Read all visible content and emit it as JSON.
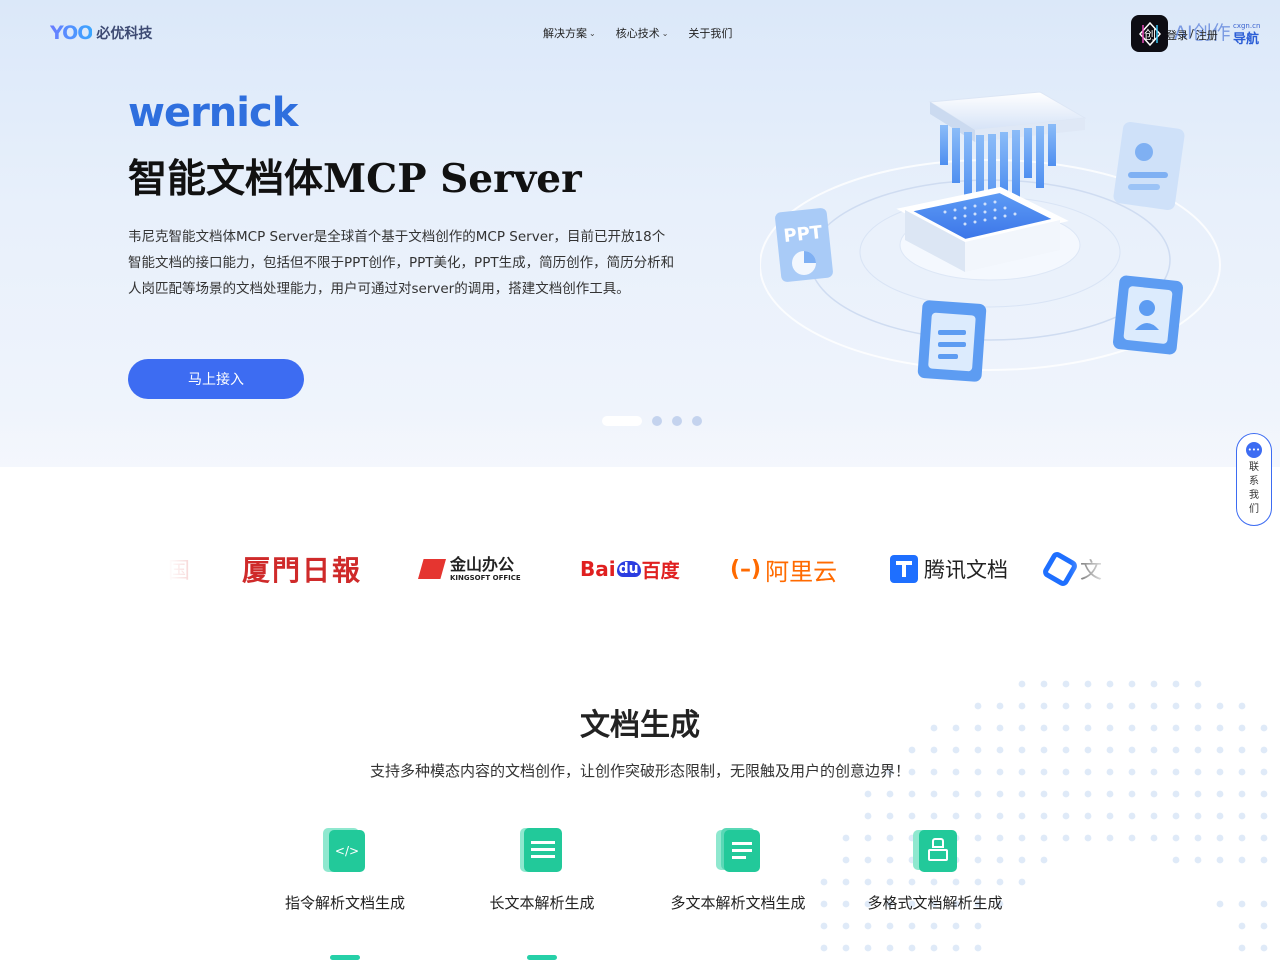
{
  "nav": {
    "logo_mark": "YOO",
    "logo_text": "必优科技",
    "menu": [
      {
        "label": "解决方案",
        "has_dropdown": true
      },
      {
        "label": "核心技术",
        "has_dropdown": true
      },
      {
        "label": "关于我们",
        "has_dropdown": false
      }
    ],
    "login": "登录",
    "register": "注册",
    "ai_nav": {
      "ai": "AI创作",
      "site": "cxgn.cn",
      "label": "导航"
    }
  },
  "hero": {
    "brand": "wernick",
    "title": "智能文档体MCP Server",
    "description": "韦尼克智能文档体MCP Server是全球首个基于文档创作的MCP Server，目前已开放18个智能文档的接口能力，包括但不限于PPT创作，PPT美化，PPT生成，简历创作，简历分析和人岗匹配等场景的文档处理能力，用户可通过对server的调用，搭建文档创作工具。",
    "cta": "马上接入",
    "carousel": {
      "count": 4,
      "active": 0
    },
    "illustration": {
      "ppt_label": "PPT"
    }
  },
  "contact": {
    "label": "联系我们"
  },
  "partners": [
    "国",
    "厦門日報",
    "金山办公",
    "KINGSOFT OFFICE",
    "Bai",
    "du",
    "百度",
    "阿里云",
    "腾讯文档",
    "文"
  ],
  "section": {
    "title": "文档生成",
    "subtitle": "支持多种模态内容的文档创作，让创作突破形态限制，无限触及用户的创意边界！",
    "features": [
      {
        "label": "指令解析文档生成",
        "icon": "code-document-icon"
      },
      {
        "label": "长文本解析生成",
        "icon": "text-document-icon"
      },
      {
        "label": "多文本解析文档生成",
        "icon": "stacked-documents-icon"
      },
      {
        "label": "多格式文档解析生成",
        "icon": "format-brush-icon"
      }
    ]
  },
  "colors": {
    "accent": "#3d6cf2",
    "brand_blue": "#2f6fde",
    "feature_green": "#26d0a8"
  }
}
